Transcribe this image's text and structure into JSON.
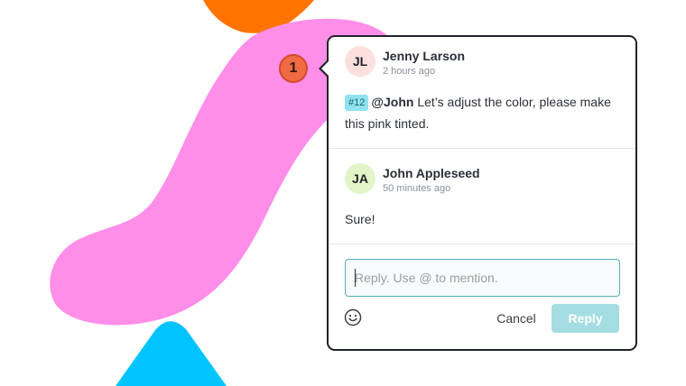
{
  "canvas": {
    "marker_label": "1",
    "colors": {
      "orange_shape": "#ff7300",
      "pink_shape": "#ff8ee8",
      "blue_shape": "#00c4ff",
      "marker": "#f06a43"
    }
  },
  "thread": {
    "comments": [
      {
        "initials": "JL",
        "author": "Jenny Larson",
        "time": "2 hours ago",
        "avatar_color": "#fbe0de",
        "tag": "#12",
        "mention": "@John",
        "text": " Let’s adjust the color, please make this pink tinted."
      },
      {
        "initials": "JA",
        "author": "John Appleseed",
        "time": "50 minutes ago",
        "avatar_color": "#e2f4c8",
        "text": "Sure!"
      }
    ]
  },
  "reply": {
    "placeholder": "Reply. Use @ to mention.",
    "value": "",
    "emoji_icon": "smiley-face-icon",
    "cancel_label": "Cancel",
    "reply_label": "Reply"
  }
}
